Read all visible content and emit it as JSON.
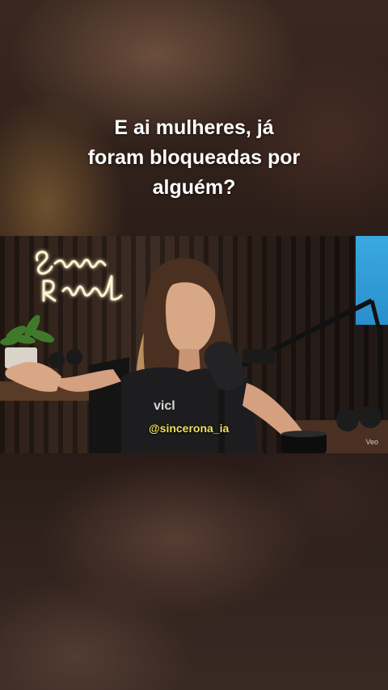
{
  "caption": {
    "lines": [
      "E ai mulheres, já",
      "foram bloqueadas por",
      "alguém?"
    ]
  },
  "video": {
    "neon_sign_text": "Secretaria Riabral",
    "watermark": "@sincerona_ia",
    "ai_label": "Veo"
  },
  "colors": {
    "caption_text": "#ffffff",
    "watermark_text": "#f2e15a",
    "neon_glow": "#ffe9a8"
  }
}
